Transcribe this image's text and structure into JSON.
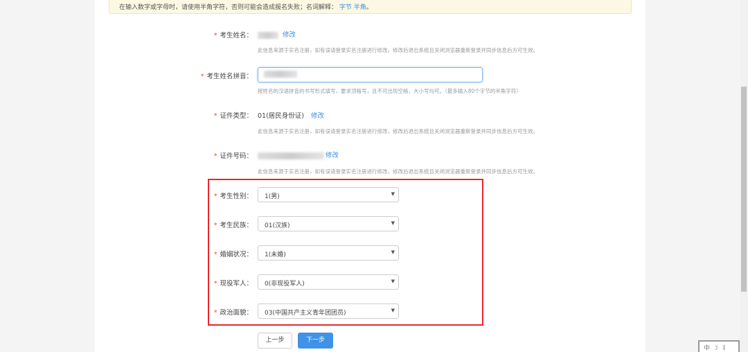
{
  "notice": {
    "text": "在输入数字或字母时，请使用半角字符，否则可能会造成报名失败；名词解释：",
    "link1": "字节",
    "link2": "半角",
    "end": "。"
  },
  "fields": {
    "name": {
      "label": "考生姓名：",
      "edit": "修改",
      "hint": "此信息来源于实名注册，如有误请登录实名注册进行修改，修改后退出系统且关闭浏览器重新登录并同步信息后方可生效。"
    },
    "pinyin": {
      "label": "考生姓名拼音：",
      "hint": "按姓名的汉语拼音的书写形式填写，要求顶格写，且不可出现空格，大小写均可。（最多输入80个字节的半角字符）"
    },
    "id_type": {
      "label": "证件类型：",
      "value": "01(居民身份证)",
      "edit": "修改",
      "hint": "此信息来源于实名注册，如有误请登录实名注册进行修改，修改后退出系统且关闭浏览器重新登录并同步信息后方可生效。"
    },
    "id_number": {
      "label": "证件号码：",
      "edit": "修改",
      "hint": "此信息来源于实名注册，如有误请登录实名注册进行修改，修改后退出系统且关闭浏览器重新登录并同步信息后方可生效。"
    }
  },
  "selects": [
    {
      "label": "考生性别：",
      "value": "1(男)"
    },
    {
      "label": "考生民族：",
      "value": "01(汉族)"
    },
    {
      "label": "婚姻状况：",
      "value": "1(未婚)"
    },
    {
      "label": "现役军人：",
      "value": "0(非现役军人)"
    },
    {
      "label": "政治面貌：",
      "value": "03(中国共产主义青年团团员)"
    }
  ],
  "required_mark": "*",
  "arrow": "▼",
  "buttons": {
    "prev": "上一步",
    "next": "下一步"
  },
  "ime": "中☽⺦"
}
